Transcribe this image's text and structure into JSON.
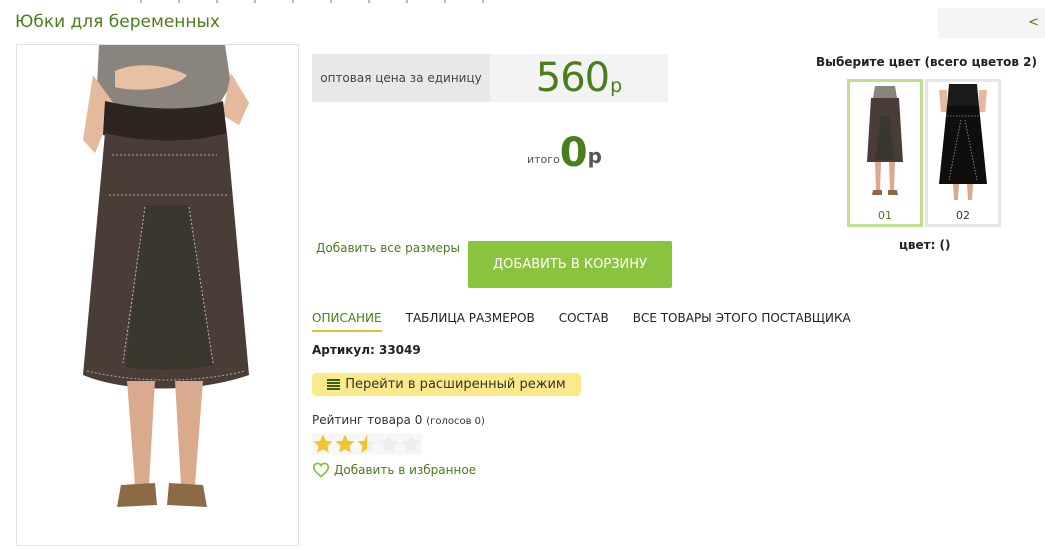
{
  "page": {
    "title": "Юбки для беременных",
    "back_label": "<"
  },
  "pricing": {
    "unit_label": "оптовая цена за единицу",
    "unit_price": "560",
    "currency": "р",
    "total_label": "итого",
    "total_value": "0",
    "total_currency": "р"
  },
  "actions": {
    "add_all_sizes": "Добавить все размеры",
    "add_to_cart": "ДОБАВИТЬ В КОРЗИНУ"
  },
  "tabs": [
    {
      "label": "ОПИСАНИЕ",
      "active": true
    },
    {
      "label": "ТАБЛИЦА РАЗМЕРОВ",
      "active": false
    },
    {
      "label": "СОСТАВ",
      "active": false
    },
    {
      "label": "ВСЕ ТОВАРЫ ЭТОГО ПОСТАВЩИКА",
      "active": false
    }
  ],
  "product": {
    "sku_label": "Артикул:",
    "sku_value": "33049",
    "extended_mode": "Перейти в расширенный режим",
    "rating_label": "Рейтинг товара",
    "rating_value": "0",
    "votes_label": "(голосов 0)",
    "stars_filled": 2.5,
    "stars_total": 5,
    "favorite": "Добавить в избранное"
  },
  "colors": {
    "title": "Выберите цвет (всего цветов 2)",
    "options": [
      {
        "label": "01",
        "selected": true
      },
      {
        "label": "02",
        "selected": false
      }
    ],
    "current_label": "цвет: ()"
  },
  "icons": {
    "list": "list-icon",
    "heart": "heart-outline-icon",
    "star": "star-icon"
  },
  "colors_ui": {
    "accent": "#8ac33e",
    "link": "#4a7d1b",
    "highlight": "#fbe98a",
    "star": "#f2c530"
  }
}
